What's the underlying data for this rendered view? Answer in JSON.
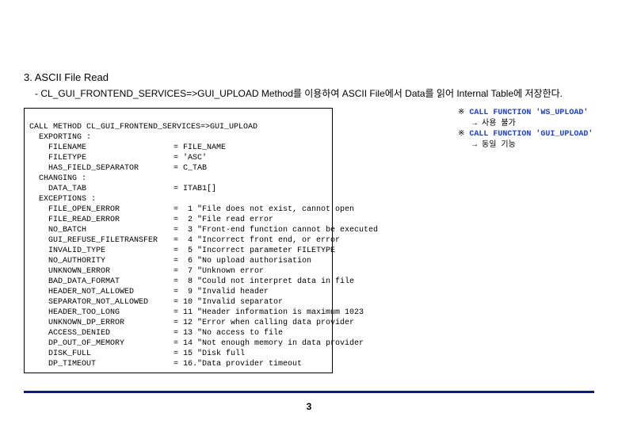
{
  "title": "3. ASCII File Read",
  "desc": "- CL_GUI_FRONTEND_SERVICES=>GUI_UPLOAD Method를 이용하여 ASCII File에서 Data를 읽어 Internal Table에 저장한다.",
  "code": {
    "l01": "CALL METHOD CL_GUI_FRONTEND_SERVICES=>GUI_UPLOAD",
    "l02": "  EXPORTING :",
    "l03a": "    FILENAME",
    "l03b": "= FILE_NAME",
    "l04a": "    FILETYPE",
    "l04b": "= 'ASC'",
    "l05a": "    HAS_FIELD_SEPARATOR",
    "l05b": "= C_TAB",
    "l06": "  CHANGING :",
    "l07a": "    DATA_TAB",
    "l07b": "= ITAB1[]",
    "l08": "  EXCEPTIONS :",
    "e01a": "    FILE_OPEN_ERROR",
    "e01b": "=  1 \"File does not exist, cannot open",
    "e02a": "    FILE_READ_ERROR",
    "e02b": "=  2 \"File read error",
    "e03a": "    NO_BATCH",
    "e03b": "=  3 \"Front-end function cannot be executed",
    "e04a": "    GUI_REFUSE_FILETRANSFER",
    "e04b": "=  4 \"Incorrect front end, or error",
    "e05a": "    INVALID_TYPE",
    "e05b": "=  5 \"Incorrect parameter FILETYPE",
    "e06a": "    NO_AUTHORITY",
    "e06b": "=  6 \"No upload authorisation",
    "e07a": "    UNKNOWN_ERROR",
    "e07b": "=  7 \"Unknown error",
    "e08a": "    BAD_DATA_FORMAT",
    "e08b": "=  8 \"Could not interpret data in file",
    "e09a": "    HEADER_NOT_ALLOWED",
    "e09b": "=  9 \"Invalid header",
    "e10a": "    SEPARATOR_NOT_ALLOWED",
    "e10b": "= 10 \"Invalid separator",
    "e11a": "    HEADER_TOO_LONG",
    "e11b": "= 11 \"Header information is maximum 1023",
    "e12a": "    UNKNOWN_DP_ERROR",
    "e12b": "= 12 \"Error when calling data provider",
    "e13a": "    ACCESS_DENIED",
    "e13b": "= 13 \"No access to file",
    "e14a": "    DP_OUT_OF_MEMORY",
    "e14b": "= 14 \"Not enough memory in data provider",
    "e15a": "    DISK_FULL",
    "e15b": "= 15 \"Disk full",
    "e16a": "    DP_TIMEOUT",
    "e16b": "= 16.\"Data provider timeout"
  },
  "side": {
    "s1a": "※ ",
    "s1b": "CALL FUNCTION 'WS_UPLOAD'",
    "s2": "   → 사용 불가",
    "s3a": "※ ",
    "s3b": "CALL FUNCTION 'GUI_UPLOAD'",
    "s4": "   → 동일 기능"
  },
  "pagenum": "3"
}
